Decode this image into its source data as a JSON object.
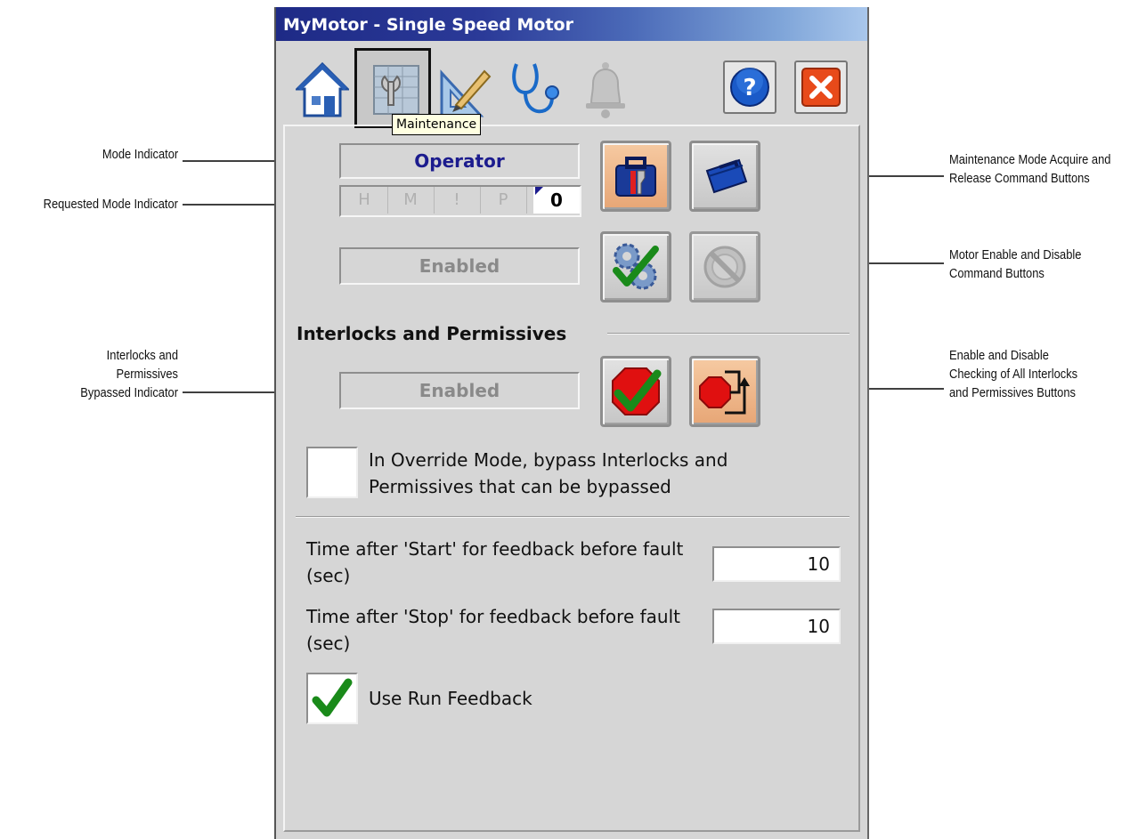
{
  "window": {
    "title": "MyMotor - Single Speed Motor"
  },
  "toolbar": {
    "tabs": [
      {
        "name": "home-icon",
        "selected": false
      },
      {
        "name": "maintenance-icon",
        "selected": true
      },
      {
        "name": "engineering-icon",
        "selected": false
      },
      {
        "name": "diagnostics-icon",
        "selected": false
      },
      {
        "name": "alarm-bell-icon",
        "selected": false
      }
    ],
    "tooltip": "Maintenance",
    "help_icon": "help-icon",
    "close_icon": "close-icon"
  },
  "mode": {
    "indicator": "Operator",
    "requested": {
      "cells": [
        "H",
        "M",
        "!",
        "P"
      ],
      "value": "0"
    }
  },
  "enable_status": "Enabled",
  "interlocks": {
    "title": "Interlocks and Permissives",
    "bypassed_indicator": "Enabled",
    "override_label": "In Override Mode, bypass Interlocks and Permissives that can be bypassed",
    "override_checked": false
  },
  "settings": {
    "start_label": "Time after 'Start' for feedback before fault (sec)",
    "start_value": "10",
    "stop_label": "Time after 'Stop' for feedback before fault (sec)",
    "stop_value": "10",
    "run_feedback_label": "Use Run Feedback",
    "run_feedback_checked": true
  },
  "callouts": {
    "mode_indicator": "Mode Indicator",
    "requested_mode_indicator": "Requested Mode Indicator",
    "bypassed_indicator": "Interlocks and Permissives Bypassed Indicator",
    "maint_buttons": "Maintenance Mode Acquire and Release Command Buttons",
    "enable_buttons": "Motor Enable and Disable Command Buttons",
    "interlock_buttons": "Enable and Disable Checking of All Interlocks and Permissives Buttons"
  },
  "colors": {
    "mode_text": "#1c1c8e",
    "orange_button": "#e7a676",
    "check_green": "#1a8a1a",
    "stop_red": "#e01010"
  }
}
